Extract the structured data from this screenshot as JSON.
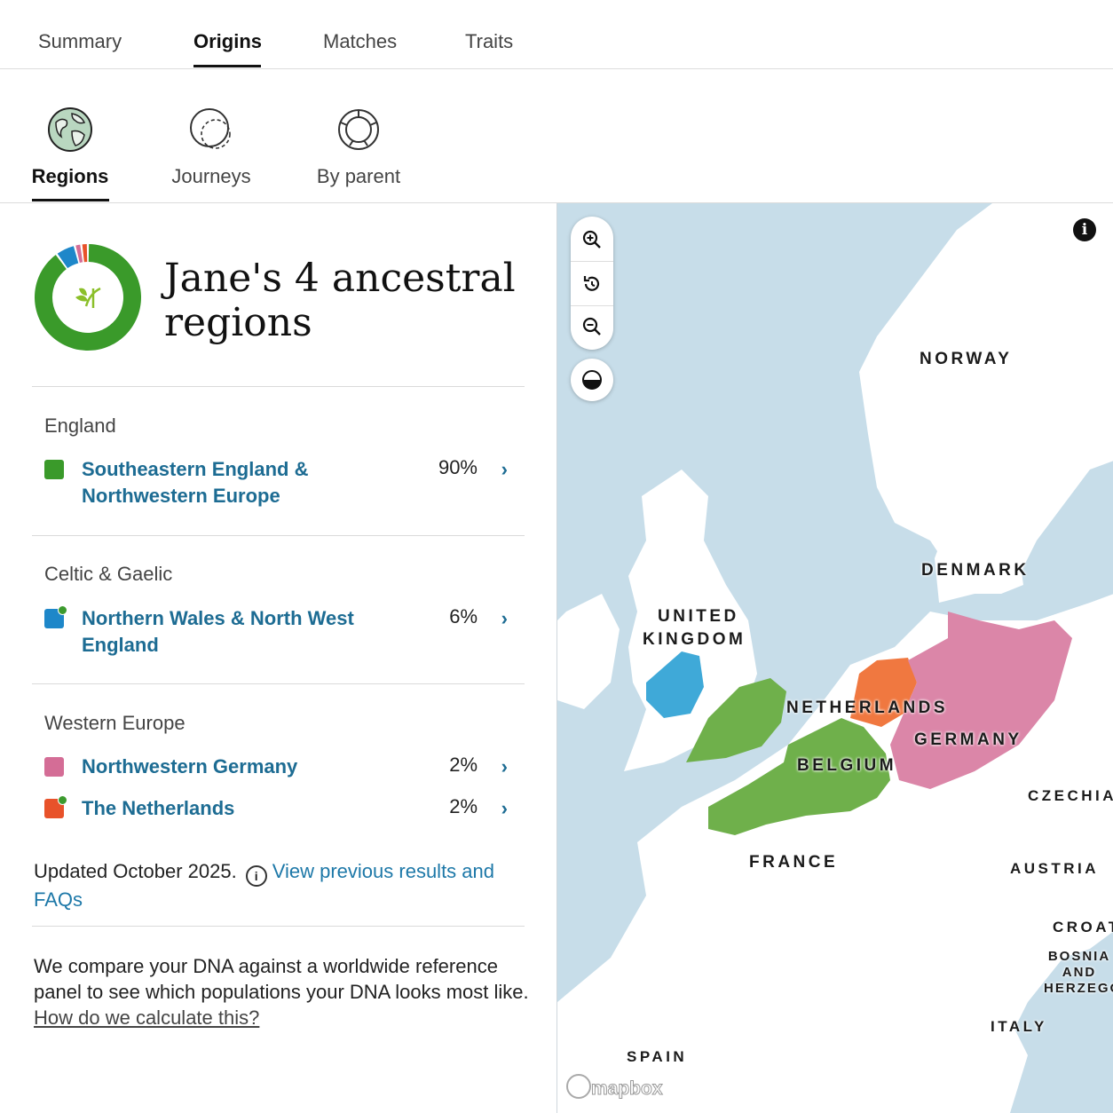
{
  "top_tabs": [
    {
      "label": "Summary"
    },
    {
      "label": "Origins",
      "active": true
    },
    {
      "label": "Matches"
    },
    {
      "label": "Traits"
    }
  ],
  "sub_tabs": [
    {
      "label": "Regions",
      "icon": "globe-icon",
      "active": true
    },
    {
      "label": "Journeys",
      "icon": "journeys-icon"
    },
    {
      "label": "By parent",
      "icon": "by-parent-icon"
    }
  ],
  "heading": {
    "line1": "Jane's 4 ancestral",
    "line2": "regions"
  },
  "groups": [
    {
      "title": "England",
      "regions": [
        {
          "name_line1": "Southeastern England &",
          "name_line2": "Northwestern Europe",
          "percent": "90%",
          "color": "#3a9a2a",
          "dot": false
        }
      ]
    },
    {
      "title": "Celtic & Gaelic",
      "regions": [
        {
          "name_line1": "Northern Wales & North West",
          "name_line2": "England",
          "percent": "6%",
          "color": "#1e87c9",
          "dot": true
        }
      ]
    },
    {
      "title": "Western Europe",
      "regions": [
        {
          "name_line1": "Northwestern Germany",
          "name_line2": "",
          "percent": "2%",
          "color": "#d46d96",
          "dot": false
        },
        {
          "name_line1": "The Netherlands",
          "name_line2": "",
          "percent": "2%",
          "color": "#e8522a",
          "dot": true
        }
      ]
    }
  ],
  "updated": {
    "text": "Updated October 2025.",
    "link": "View previous results and FAQs"
  },
  "description": {
    "text": "We compare your DNA against a worldwide reference panel to see which populations your DNA looks most like.",
    "link": "How do we calculate this?"
  },
  "map": {
    "labels": {
      "norway": "NORWAY",
      "denmark": "DENMARK",
      "uk1": "UNITED",
      "uk2": "KINGDOM",
      "netherlands": "NETHERLANDS",
      "germany": "GERMANY",
      "belgium": "BELGIUM",
      "czechia": "CZECHIA",
      "france": "FRANCE",
      "austria": "AUSTRIA",
      "croatia": "CROAT",
      "bosnia1": "BOSNIA",
      "bosnia2": "AND",
      "bosnia3": "HERZEGOV",
      "italy": "ITALY",
      "spain": "SPAIN"
    },
    "attribution": "mapbox",
    "colors": {
      "sea": "#c7dde9",
      "land": "#ffffff",
      "england": "#6fb04b",
      "wales": "#3fa9d8",
      "germany": "#db86a8",
      "netherlands": "#f07840"
    }
  },
  "donut": {
    "segments_percent": [
      90,
      6,
      2,
      2
    ],
    "colors": [
      "#3a9a2a",
      "#1e87c9",
      "#d46d96",
      "#e8522a"
    ]
  }
}
